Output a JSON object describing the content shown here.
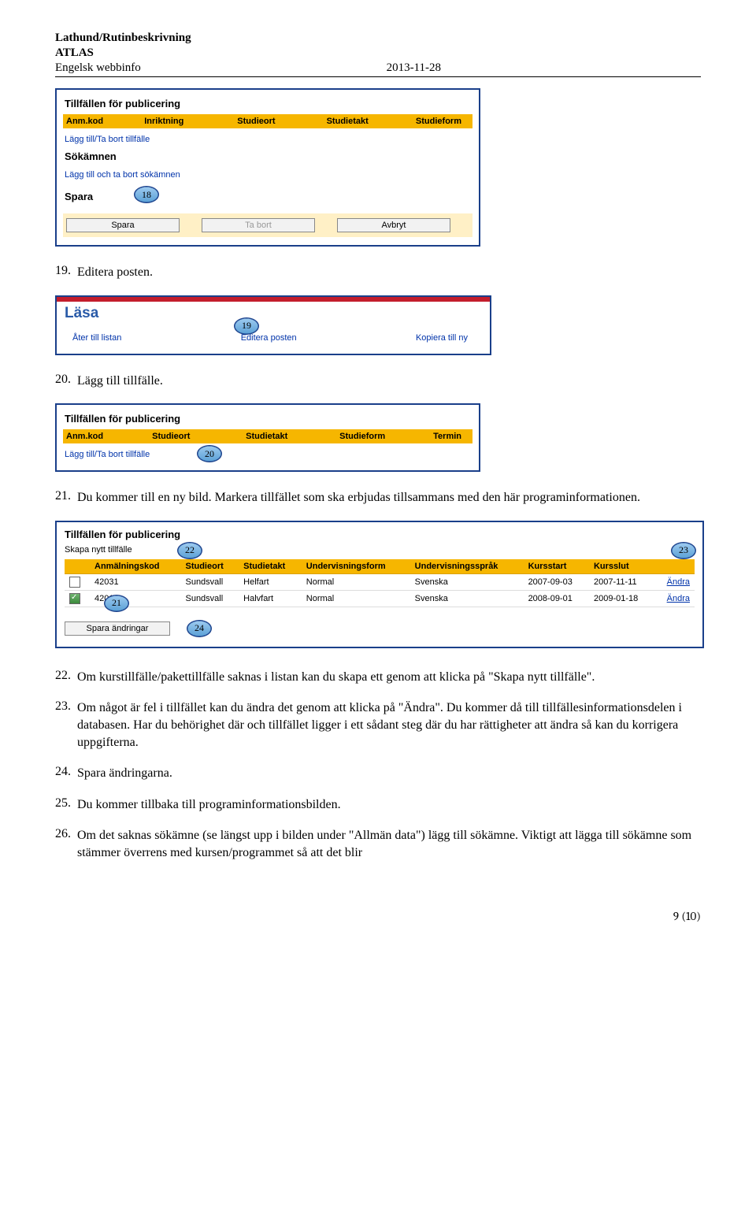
{
  "doc_header": {
    "line1": "Lathund/Rutinbeskrivning",
    "line2": "ATLAS",
    "left": "Engelsk webbinfo",
    "right": "2013-11-28"
  },
  "panel1": {
    "title1": "Tillfällen för publicering",
    "headers": [
      "Anm.kod",
      "Inriktning",
      "Studieort",
      "Studietakt",
      "Studieform"
    ],
    "link1": "Lägg till/Ta bort tillfälle",
    "title2": "Sökämnen",
    "link2": "Lägg till och ta bort sökämnen",
    "title3": "Spara",
    "btn_spara": "Spara",
    "btn_tabort": "Ta bort",
    "btn_avbryt": "Avbryt",
    "callout": "18"
  },
  "step19": {
    "num": "19.",
    "text": "Editera posten."
  },
  "panel2": {
    "readlabel": "Läsa",
    "links": [
      "Åter till listan",
      "Editera posten",
      "Kopiera till ny"
    ],
    "callout": "19"
  },
  "step20": {
    "num": "20.",
    "text": "Lägg till tillfälle."
  },
  "panel2b": {
    "title": "Tillfällen för publicering",
    "headers": [
      "Anm.kod",
      "Studieort",
      "Studietakt",
      "Studieform",
      "Termin"
    ],
    "link": "Lägg till/Ta bort tillfälle",
    "callout": "20"
  },
  "step21": {
    "num": "21.",
    "text": "Du kommer till en ny bild. Markera tillfället som ska erbjudas tillsammans med den här programinformationen."
  },
  "panel3": {
    "title": "Tillfällen för publicering",
    "link_top": "Skapa nytt tillfälle",
    "headers": [
      "",
      "Anmälningskod",
      "Studieort",
      "Studietakt",
      "Undervisningsform",
      "Undervisningsspråk",
      "Kursstart",
      "Kursslut",
      ""
    ],
    "rows": [
      {
        "chk": false,
        "kod": "42031",
        "ort": "Sundsvall",
        "takt": "Helfart",
        "form": "Normal",
        "sprak": "Svenska",
        "start": "2007-09-03",
        "slut": "2007-11-11",
        "andra": "Ändra"
      },
      {
        "chk": true,
        "kod": "42011",
        "ort": "Sundsvall",
        "takt": "Halvfart",
        "form": "Normal",
        "sprak": "Svenska",
        "start": "2008-09-01",
        "slut": "2009-01-18",
        "andra": "Ändra"
      }
    ],
    "btn": "Spara ändringar",
    "c21": "21",
    "c22": "22",
    "c23": "23",
    "c24": "24"
  },
  "step22": {
    "num": "22.",
    "text": "Om kurstillfälle/pakettillfälle saknas i listan kan du skapa ett genom att klicka på \"Skapa nytt tillfälle\"."
  },
  "step23": {
    "num": "23.",
    "text": "Om något är fel i tillfället kan du ändra det genom att klicka på \"Ändra\". Du kommer då till tillfällesinformationsdelen i databasen. Har du behörighet där och tillfället ligger i ett sådant steg där du har rättigheter att ändra så kan du korrigera uppgifterna."
  },
  "step24": {
    "num": "24.",
    "text": "Spara ändringarna."
  },
  "step25": {
    "num": "25.",
    "text": "Du kommer tillbaka till programinformationsbilden."
  },
  "step26": {
    "num": "26.",
    "text": "Om det saknas sökämne (se längst upp i bilden under \"Allmän data\") lägg till sökämne. Viktigt att lägga till sökämne som stämmer överrens med kursen/programmet så att det blir"
  },
  "footer": "9 (10)"
}
